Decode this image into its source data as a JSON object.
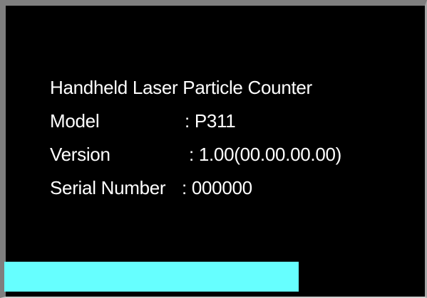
{
  "device": {
    "title": "Handheld Laser Particle Counter",
    "model_label": "Model",
    "model_value": ": P311",
    "version_label": "Version",
    "version_value": ": 1.00(00.00.00.00)",
    "serial_label": "Serial Number",
    "serial_value": ": 000000"
  },
  "progress": {
    "fraction": 0.7
  },
  "colors": {
    "background": "#000000",
    "text": "#ffffff",
    "progress": "#66ffff",
    "frame": "#7f7f7f"
  }
}
